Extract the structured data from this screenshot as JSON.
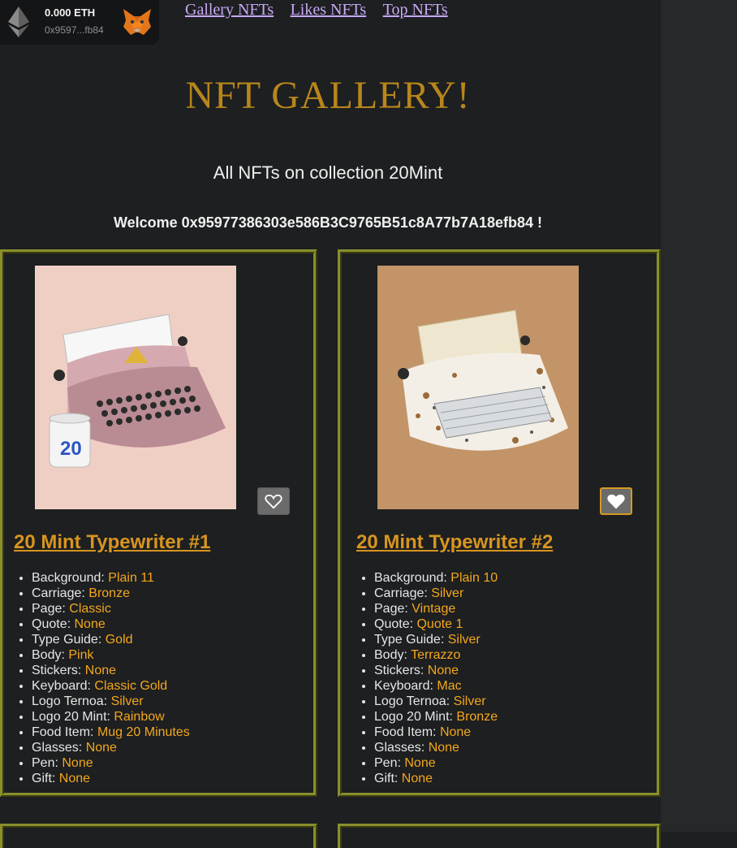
{
  "wallet": {
    "balance": "0.000 ETH",
    "address": "0x9597...fb84"
  },
  "nav": {
    "links": [
      "Gallery NFTs",
      "Likes NFTs",
      "Top NFTs"
    ]
  },
  "page": {
    "title": "NFT GALLERY!",
    "subtitle": "All NFTs on collection 20Mint",
    "welcome": "Welcome 0x95977386303e586B3C9765B51c8A77b7A18efb84 !"
  },
  "colors": {
    "accent": "#d7951f",
    "title": "#b8861b",
    "link": "#c9a8f5",
    "border": "#8a8f2c"
  },
  "nfts": [
    {
      "name": "20 Mint Typewriter #1",
      "liked": false,
      "traits": [
        {
          "label": "Background:",
          "value": "Plain 11"
        },
        {
          "label": "Carriage:",
          "value": "Bronze"
        },
        {
          "label": "Page:",
          "value": "Classic"
        },
        {
          "label": "Quote:",
          "value": "None"
        },
        {
          "label": "Type Guide:",
          "value": "Gold"
        },
        {
          "label": "Body:",
          "value": "Pink"
        },
        {
          "label": "Stickers:",
          "value": "None"
        },
        {
          "label": "Keyboard:",
          "value": "Classic Gold"
        },
        {
          "label": "Logo Ternoa:",
          "value": "Silver"
        },
        {
          "label": "Logo 20 Mint:",
          "value": "Rainbow"
        },
        {
          "label": "Food Item:",
          "value": "Mug 20 Minutes"
        },
        {
          "label": "Glasses:",
          "value": "None"
        },
        {
          "label": "Pen:",
          "value": "None"
        },
        {
          "label": "Gift:",
          "value": "None"
        }
      ]
    },
    {
      "name": "20 Mint Typewriter #2",
      "liked": true,
      "traits": [
        {
          "label": "Background:",
          "value": "Plain 10"
        },
        {
          "label": "Carriage:",
          "value": "Silver"
        },
        {
          "label": "Page:",
          "value": "Vintage"
        },
        {
          "label": "Quote:",
          "value": "Quote 1"
        },
        {
          "label": "Type Guide:",
          "value": "Silver"
        },
        {
          "label": "Body:",
          "value": "Terrazzo"
        },
        {
          "label": "Stickers:",
          "value": "None"
        },
        {
          "label": "Keyboard:",
          "value": "Mac"
        },
        {
          "label": "Logo Ternoa:",
          "value": "Silver"
        },
        {
          "label": "Logo 20 Mint:",
          "value": "Bronze"
        },
        {
          "label": "Food Item:",
          "value": "None"
        },
        {
          "label": "Glasses:",
          "value": "None"
        },
        {
          "label": "Pen:",
          "value": "None"
        },
        {
          "label": "Gift:",
          "value": "None"
        }
      ]
    }
  ],
  "mug_text": "20"
}
